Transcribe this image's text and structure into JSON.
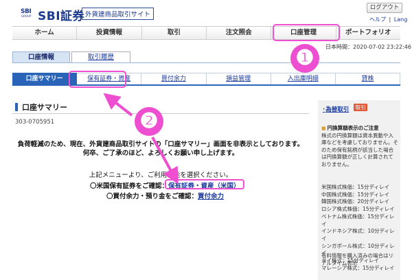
{
  "header": {
    "logo_mark": "SBI",
    "logo_mark_sub": "GROUP",
    "logo_text": "SBI証券",
    "site_name": "外貨建商品取引サイト",
    "logout": "ログアウト",
    "help": "ヘルプ",
    "separator": "|",
    "lang": "Lang"
  },
  "main_nav": [
    "ホーム",
    "投資情報",
    "取引",
    "注文照会",
    "口座管理",
    "ポートフォリオ"
  ],
  "datetime": {
    "label": "日本時間：",
    "value": "2020-07-02 23:22:46"
  },
  "sub_tabs": {
    "active": "口座情報",
    "inactive": "取引履歴"
  },
  "tabs": [
    "口座サマリー",
    "保有証券・資産",
    "買付余力",
    "損益管理",
    "入出庫明細",
    "貸株"
  ],
  "page": {
    "title": "口座サマリー",
    "account_no": "303-0705951",
    "notice_line1": "負荷軽減のため、現在、外貨建商品取引サイトの「口座サマリー」画面を非表示としております。",
    "notice_line2": "何卒、ご了承のほど、よろしくお願い申し上げます。",
    "menu_note": "上記メニューより、ご利用機能を選択ください。",
    "link1_prefix": "〇米国保有証券をご確認：",
    "link1_text": "保有証券・資産（米国）",
    "link2_prefix": "〇買付余力・預り金をご確認：",
    "link2_text": "買付余力"
  },
  "right_panel": {
    "fx_link": "為替取引",
    "fx_button": "取引",
    "warn_title": "円換算額表示のご注意",
    "warn_body": "株式の円換算額は資本異動や入庫などを考慮しておりません。そのため保有銘柄が該当した場合は円換算額が正しく計算されておりません。",
    "delays": [
      "米国株式株価：15分ディレイ",
      "中国株式株価：15分ディレイ",
      "韓国株式株価：20分ディレイ",
      "ロシア株式株価：15分ディレイ",
      "ベトナム株式株価：15分ディレイ",
      "インドネシア株式：10分ディレイ",
      "シンガポール株式：10分ディレイ",
      "タイ株式：15分ディレイ",
      "マレーシア株式：15分ディレイ"
    ],
    "footer": "有料情報を購入済みの場合はリアルタイム表示"
  },
  "annotations": {
    "num1": "❶",
    "num2": "❷",
    "color": "#ee4fd0"
  }
}
